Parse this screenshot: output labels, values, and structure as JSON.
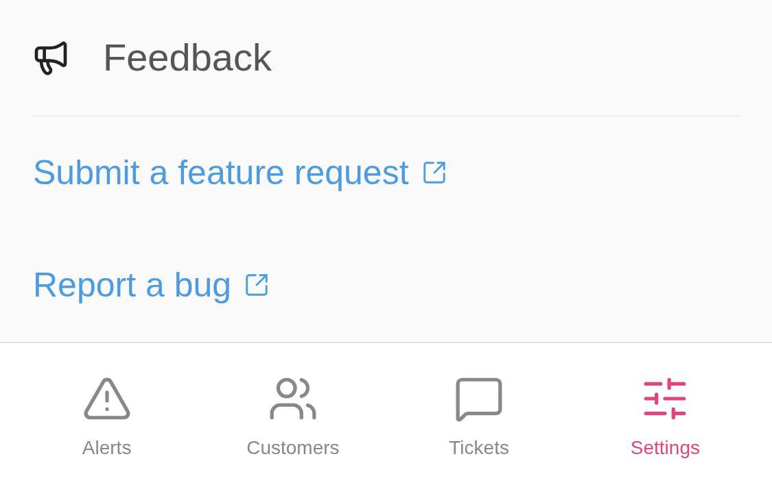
{
  "header": {
    "title": "Feedback"
  },
  "links": [
    {
      "label": "Submit a feature request"
    },
    {
      "label": "Report a bug"
    }
  ],
  "tabs": [
    {
      "label": "Alerts",
      "kind": "alert",
      "selected": false
    },
    {
      "label": "Customers",
      "kind": "people",
      "selected": false
    },
    {
      "label": "Tickets",
      "kind": "message",
      "selected": false
    },
    {
      "label": "Settings",
      "kind": "sliders",
      "selected": true
    }
  ]
}
